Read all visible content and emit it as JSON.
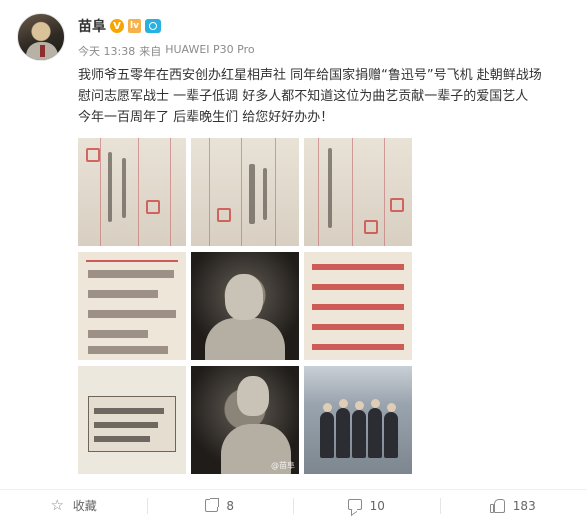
{
  "post": {
    "username": "苗阜",
    "badges": {
      "verified": "V",
      "level": "lv",
      "camera": "camera-badge-icon"
    },
    "meta": {
      "time": "今天 13:38",
      "source_prefix": "来自",
      "source": "HUAWEI P30 Pro"
    },
    "content_lines": [
      "我师爷五零年在西安创办红星相声社 同年给国家捐赠“鲁迅号”号飞机 赴朝鲜战场",
      "慰问志愿军战士 一辈子低调 好多人都不知道这位为曲艺贡献一辈子的爱国艺人",
      "今年一百周年了 后辈晚生们 给您好好办办！"
    ],
    "images": [
      {
        "icon": "document-photo"
      },
      {
        "icon": "document-photo"
      },
      {
        "icon": "document-photo"
      },
      {
        "icon": "newspaper-photo"
      },
      {
        "icon": "portrait-photo"
      },
      {
        "icon": "poster-photo"
      },
      {
        "icon": "clipping-photo"
      },
      {
        "icon": "portrait-photo"
      },
      {
        "icon": "group-photo"
      }
    ],
    "watermark": "@苗阜"
  },
  "actions": {
    "favorite": {
      "label": "收藏",
      "icon": "star-icon"
    },
    "repost": {
      "count": "8",
      "icon": "share-icon"
    },
    "comment": {
      "count": "10",
      "icon": "comment-icon"
    },
    "like": {
      "count": "183",
      "icon": "thumbs-up-icon"
    }
  },
  "colors": {
    "accent_v": "#f7a500",
    "text": "#333333",
    "meta": "#8b8b8b"
  }
}
